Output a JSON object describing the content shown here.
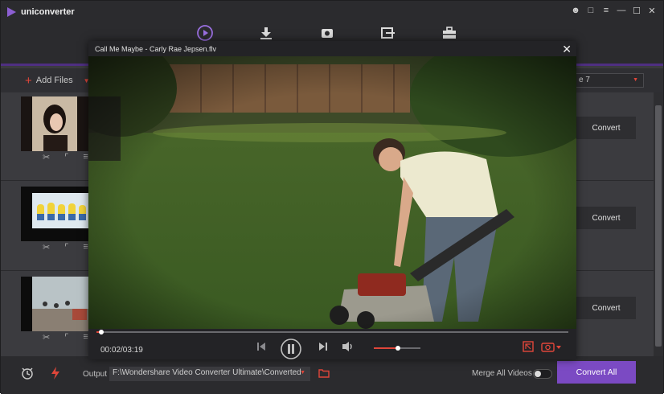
{
  "app": {
    "name": "uniconverter",
    "window_controls": [
      "user-icon",
      "chat-icon",
      "menu-icon",
      "minimize-icon",
      "maximize-icon",
      "close-icon"
    ],
    "nav_icons": [
      "convert-icon",
      "download-icon",
      "record-icon",
      "transfer-icon",
      "toolbox-icon"
    ],
    "active_nav": "convert-icon",
    "accent": "#7b4ac3",
    "warning_red": "#e0463a"
  },
  "toolbar": {
    "add_files_label": "Add Files",
    "format_value": "e 7"
  },
  "files": [
    {
      "convert_label": "Convert",
      "tools": [
        "scissors-icon",
        "crop-icon",
        "effects-icon"
      ]
    },
    {
      "convert_label": "Convert",
      "tools": [
        "scissors-icon",
        "crop-icon",
        "effects-icon"
      ]
    },
    {
      "convert_label": "Convert",
      "tools": [
        "scissors-icon",
        "crop-icon",
        "effects-icon"
      ]
    }
  ],
  "bottom": {
    "output_label": "Output",
    "output_path": "F:\\Wondershare Video Converter Ultimate\\Converted",
    "merge_label": "Merge All Videos",
    "merge_on": false,
    "convert_all_label": "Convert All"
  },
  "player": {
    "title": "Call Me Maybe - Carly Rae Jepsen.flv",
    "time": "00:02/03:19",
    "progress_fraction": 0.01,
    "volume_fraction": 0.52
  }
}
